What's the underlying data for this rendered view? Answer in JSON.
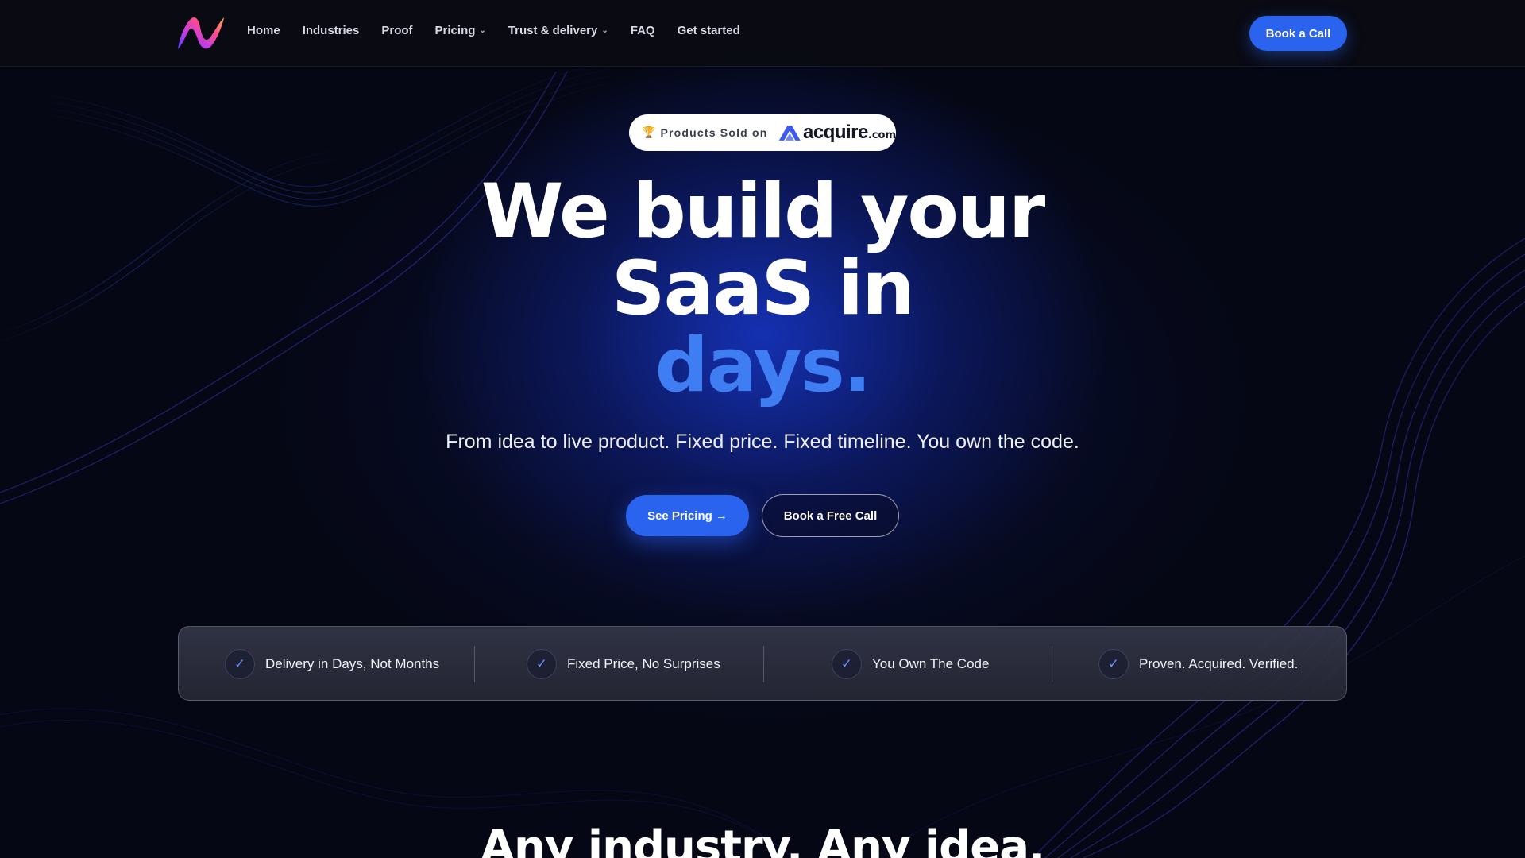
{
  "nav": {
    "items": [
      {
        "label": "Home",
        "dropdown": false
      },
      {
        "label": "Industries",
        "dropdown": false
      },
      {
        "label": "Proof",
        "dropdown": false
      },
      {
        "label": "Pricing",
        "dropdown": true
      },
      {
        "label": "Trust & delivery",
        "dropdown": true
      },
      {
        "label": "FAQ",
        "dropdown": false
      },
      {
        "label": "Get started",
        "dropdown": false
      }
    ],
    "cta_label": "Book a Call"
  },
  "badge": {
    "icon": "trophy-icon",
    "label": "Products Sold on",
    "brand_word": "acquire",
    "brand_suffix": ".com"
  },
  "hero": {
    "title_line1": "We build your",
    "title_line2": "SaaS in",
    "title_accent": "days.",
    "subtitle": "From idea to live product. Fixed price. Fixed timeline. You own the code.",
    "primary_button": "See Pricing →",
    "secondary_button": "Book a Free Call"
  },
  "features": [
    {
      "icon": "check-icon",
      "label": "Delivery in Days, Not Months"
    },
    {
      "icon": "check-icon",
      "label": "Fixed Price, No Surprises"
    },
    {
      "icon": "check-icon",
      "label": "You Own The Code"
    },
    {
      "icon": "check-icon",
      "label": "Proven. Acquired. Verified."
    }
  ],
  "next_section": {
    "heading": "Any industry. Any idea."
  },
  "colors": {
    "background": "#050714",
    "accent": "#2a64ee",
    "accent_text": "#3f7df3",
    "check": "#5a90ff"
  }
}
